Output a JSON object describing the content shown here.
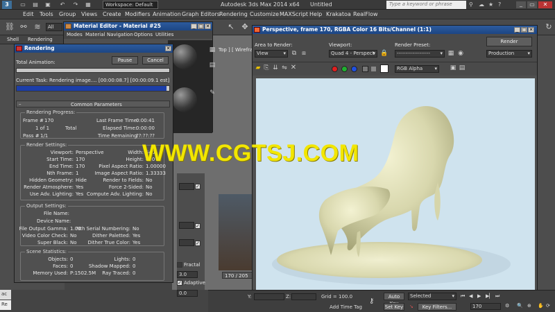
{
  "titlebar": {
    "app_icon_label": "3",
    "workspace_label": "Workspace: Default",
    "app_title": "Autodesk 3ds Max  2014 x64",
    "doc_title": "Untitled",
    "search_placeholder": "Type a keyword or phrase"
  },
  "menubar": {
    "items": [
      "Edit",
      "Tools",
      "Group",
      "Views",
      "Create",
      "Modifiers",
      "Animation",
      "Graph Editors",
      "Rendering",
      "Customize",
      "MAXScript",
      "Help",
      "Krakatoa",
      "RealFlow"
    ]
  },
  "toolbar": {
    "all_label": "All",
    "left_tabs": [
      "Shell",
      "Rendering"
    ]
  },
  "material_editor": {
    "title": "Material Editor - Material #25",
    "menu": [
      "Modes",
      "Material",
      "Navigation",
      "Options",
      "Utilities"
    ]
  },
  "rendering_dialog": {
    "title": "Rendering",
    "total_animation_label": "Total Animation:",
    "pause_label": "Pause",
    "cancel_label": "Cancel",
    "current_task_label": "Current Task:",
    "current_task_value": "Rendering image.... [00:00:08.7] [00:00:09.1 est]",
    "progress_fraction": 0.98,
    "common_params_label": "Common Parameters",
    "progress_group": {
      "title": "Rendering Progress:",
      "frame_label": "Frame #",
      "frame_value": "170",
      "of_value": "1 of 1",
      "total_label": "Total",
      "pass_label": "Pass #",
      "pass_value": "1/1",
      "last_frame_time_label": "Last Frame Time:",
      "last_frame_time_value": "0:00:41",
      "elapsed_time_label": "Elapsed Time:",
      "elapsed_time_value": "0:00:00",
      "time_remaining_label": "Time Remaining:",
      "time_remaining_value": "??:??:??"
    },
    "render_settings": {
      "title": "Render Settings:",
      "rows": [
        {
          "k": "Viewport:",
          "v": "Perspective",
          "k2": "Width:",
          "v2": "640"
        },
        {
          "k": "Start Time:",
          "v": "170",
          "k2": "Height:",
          "v2": "480"
        },
        {
          "k": "End Time:",
          "v": "170",
          "k2": "Pixel Aspect Ratio:",
          "v2": "1.00000"
        },
        {
          "k": "Nth Frame:",
          "v": "1",
          "k2": "Image Aspect Ratio:",
          "v2": "1.33333"
        },
        {
          "k": "Hidden Geometry:",
          "v": "Hide",
          "k2": "Render to Fields:",
          "v2": "No"
        },
        {
          "k": "Render Atmosphere:",
          "v": "Yes",
          "k2": "Force 2-Sided:",
          "v2": "No"
        },
        {
          "k": "Use Adv. Lighting:",
          "v": "Yes",
          "k2": "Compute Adv. Lighting:",
          "v2": "No"
        }
      ]
    },
    "output_settings": {
      "title": "Output Settings:",
      "file_name_label": "File Name:",
      "device_name_label": "Device Name:",
      "rows": [
        {
          "k": "File Output Gamma:",
          "v": "1.00",
          "k2": "Nth Serial Numbering:",
          "v2": "No"
        },
        {
          "k": "Video Color Check:",
          "v": "No",
          "k2": "Dither Paletted:",
          "v2": "Yes"
        },
        {
          "k": "Super Black:",
          "v": "No",
          "k2": "Dither True Color:",
          "v2": "Yes"
        }
      ]
    },
    "scene_statistics": {
      "title": "Scene Statistics:",
      "rows": [
        {
          "k": "Objects:",
          "v": "0",
          "k2": "Lights:",
          "v2": "0"
        },
        {
          "k": "Faces:",
          "v": "0",
          "k2": "Shadow Mapped:",
          "v2": "0"
        },
        {
          "k": "Memory Used:",
          "v": "P:1502.5M",
          "k2": "Ray Traced:",
          "v2": "0"
        }
      ]
    }
  },
  "render_frame": {
    "title": "Perspective, frame 170, RGBA Color 16 Bits/Channel (1:1)",
    "area_to_render_label": "Area to Render:",
    "area_to_render_value": "View",
    "viewport_label": "Viewport:",
    "viewport_value": "Quad 4 - Perspect",
    "render_preset_label": "Render Preset:",
    "render_preset_value": "-------------------",
    "render_button": "Render",
    "production_value": "Production",
    "channel_value": "RGB Alpha"
  },
  "viewport": {
    "label": "Top ] [ Wirefra",
    "timeline": "170 / 205"
  },
  "command_panel": {
    "fractal_label": "Fractal",
    "adaptive_label": "Adaptive",
    "value_a": "3.0",
    "value_b": "0.0"
  },
  "statusbar": {
    "y_label": "Y:",
    "z_label": "Z:",
    "grid_label": "Grid = 100.0",
    "add_time_tag": "Add Time Tag",
    "auto_key": "Auto Key",
    "selected_value": "Selected",
    "set_key": "Set Key",
    "key_filters": "Key Filters...",
    "frame_value": "170"
  },
  "watermark": "WWW.CGTSJ.COM",
  "bottom_left": {
    "label_a": "ac",
    "label_b": "Re"
  }
}
